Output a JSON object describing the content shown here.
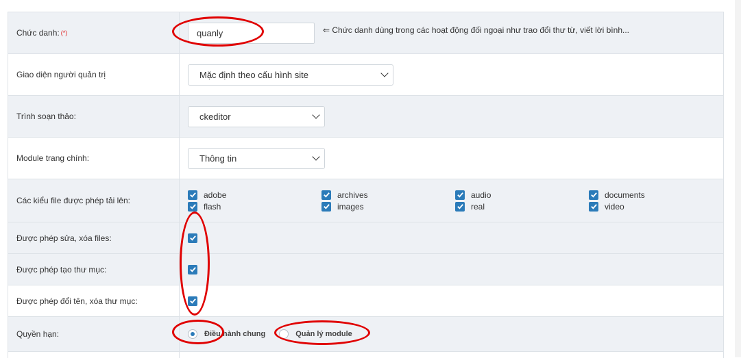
{
  "fields": {
    "title": {
      "label": "Chức danh:",
      "required_mark": "(*)",
      "value": "quanly",
      "hint": "⇐ Chức danh dùng trong các hoạt động đối ngoại như trao đổi thư từ, viết lời bình..."
    },
    "admin_theme": {
      "label": "Giao diện người quản trị",
      "selected": "Mặc định theo cấu hình site"
    },
    "editor": {
      "label": "Trình soạn thảo:",
      "selected": "ckeditor"
    },
    "main_module": {
      "label": "Module trang chính:",
      "selected": "Thông tin"
    },
    "file_types": {
      "label": "Các kiểu file được phép tải lên:",
      "options": [
        {
          "name": "adobe",
          "checked": true
        },
        {
          "name": "archives",
          "checked": true
        },
        {
          "name": "audio",
          "checked": true
        },
        {
          "name": "documents",
          "checked": true
        },
        {
          "name": "flash",
          "checked": true
        },
        {
          "name": "images",
          "checked": true
        },
        {
          "name": "real",
          "checked": true
        },
        {
          "name": "video",
          "checked": true
        }
      ]
    },
    "allow_edit_delete_files": {
      "label": "Được phép sửa, xóa files:",
      "checked": true
    },
    "allow_create_folder": {
      "label": "Được phép tạo thư mục:",
      "checked": true
    },
    "allow_rename_delete_folder": {
      "label": "Được phép đổi tên, xóa thư mục:",
      "checked": true
    },
    "permission": {
      "label": "Quyền hạn:",
      "options": [
        {
          "label": "Điều hành chung",
          "selected": true
        },
        {
          "label": "Quản lý module",
          "selected": false
        }
      ]
    }
  },
  "colors": {
    "accent": "#2b7bb9",
    "annotation": "#e00000",
    "row_alt": "#eef1f5"
  }
}
